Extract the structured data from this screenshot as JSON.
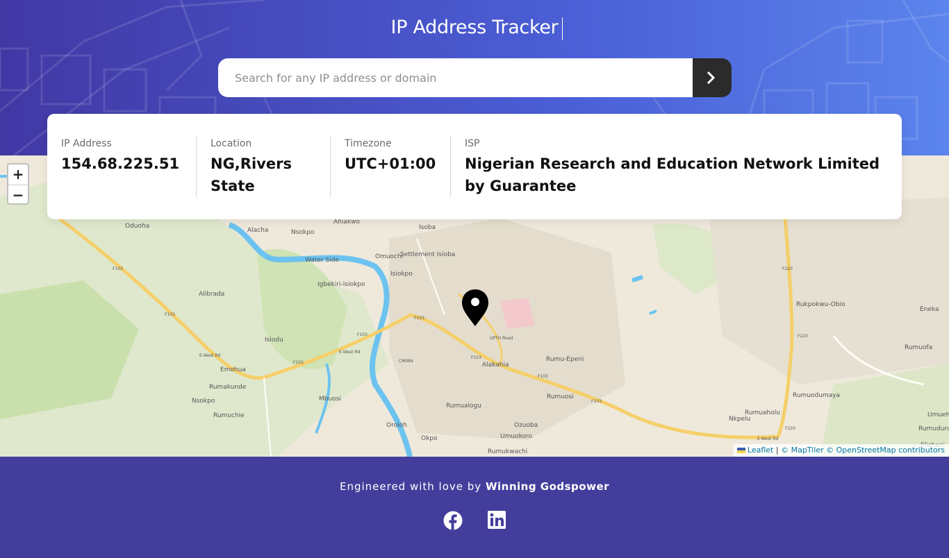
{
  "app": {
    "title": "IP Address Tracker"
  },
  "search": {
    "placeholder": "Search for any IP address or domain",
    "value": "",
    "button_icon": "chevron-right-icon"
  },
  "info": {
    "ip": {
      "label": "IP Address",
      "value": "154.68.225.51"
    },
    "location": {
      "label": "Location",
      "value_line1": "NG,Rivers",
      "value_line2": "State"
    },
    "timezone": {
      "label": "Timezone",
      "value": "UTC+01:00"
    },
    "isp": {
      "label": "ISP",
      "value_line1": "Nigerian Research and Education Network Limited",
      "value_line2": "by Guarantee"
    }
  },
  "map": {
    "zoom_in": "+",
    "zoom_out": "−",
    "places": [
      "Oduoha",
      "Alacha",
      "Nsokpo",
      "Ahiakwo",
      "Isoba",
      "Omuochi",
      "Settlement Isioba",
      "Water Side",
      "Isiokpo",
      "Igbekiri-Isiokpo",
      "Alibrada",
      "Isiodu",
      "Emohua",
      "Rumakunde",
      "Nsokpo",
      "Rumuchie",
      "Mbuosi",
      "Oroloh",
      "Okpo",
      "Alakahia",
      "Rumualogu",
      "Ozuoba",
      "Umuokoro",
      "Rumukwachi",
      "Rumu-Epeni",
      "Rumuosi",
      "Nkpelu",
      "Rumuaholu",
      "Rumuodumaya",
      "Rukpokwu-Obio",
      "Eneka",
      "Rumuofa",
      "Umueher",
      "Rumuduru",
      "Elichani"
    ],
    "road_labels": [
      "F103",
      "F103",
      "F103",
      "F102",
      "F103",
      "F103",
      "F103",
      "F103",
      "F220",
      "F220",
      "F220",
      "CM084",
      "E-West Rd",
      "E-West Rd",
      "E-West Rd",
      "UPTH Road"
    ],
    "attribution": {
      "leaflet": "Leaflet",
      "sep": "|",
      "maptiler": "© MapTiler",
      "osm": "© OpenStreetMap contributors"
    },
    "marker_icon": "location-pin-icon"
  },
  "footer": {
    "credit_prefix": "Engineered with love by",
    "credit_name": "Winning Godspower",
    "social": [
      "facebook-icon",
      "linkedin-icon"
    ]
  },
  "colors": {
    "header_start": "#4138a4",
    "header_end": "#5b84ec",
    "footer": "#433e9c",
    "button": "#2b2b2b",
    "river": "#6cc3f0",
    "road": "#f5cf6a"
  }
}
